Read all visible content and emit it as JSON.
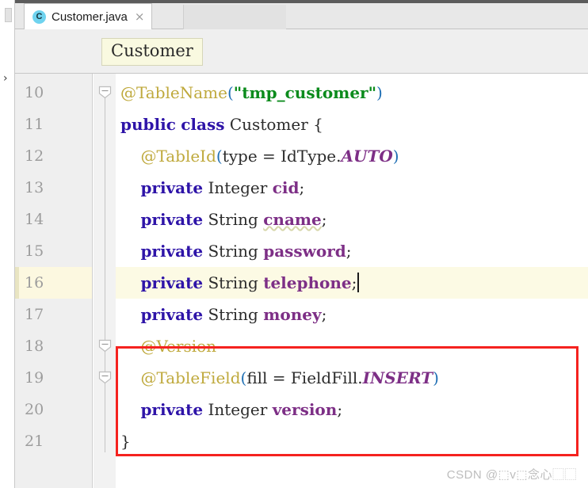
{
  "window": {
    "app": "IntelliJ IDEA editor"
  },
  "left_strip": {
    "chevron_icon": "›"
  },
  "tabbar": {
    "tab": {
      "icon_letter": "C",
      "label": "Customer.java",
      "close_icon": "×"
    }
  },
  "breadcrumb": {
    "label": "Customer"
  },
  "editor": {
    "lines": [
      {
        "number": "10",
        "active": false,
        "fold": "collapse",
        "tokens": [
          {
            "t": "@TableName",
            "c": "anno"
          },
          {
            "t": "(",
            "c": "paren"
          },
          {
            "t": "\"tmp_customer\"",
            "c": "str"
          },
          {
            "t": ")",
            "c": "paren"
          }
        ]
      },
      {
        "number": "11",
        "active": false,
        "fold": "",
        "tokens": [
          {
            "t": "public",
            "c": "kw"
          },
          {
            "t": " ",
            "c": "plain"
          },
          {
            "t": "class",
            "c": "kw"
          },
          {
            "t": " ",
            "c": "plain"
          },
          {
            "t": "Customer",
            "c": "type"
          },
          {
            "t": " {",
            "c": "punc"
          }
        ]
      },
      {
        "number": "12",
        "active": false,
        "fold": "",
        "tokens": [
          {
            "t": "    ",
            "c": "plain"
          },
          {
            "t": "@TableId",
            "c": "anno"
          },
          {
            "t": "(",
            "c": "paren"
          },
          {
            "t": "type = ",
            "c": "plain"
          },
          {
            "t": "IdType.",
            "c": "plain"
          },
          {
            "t": "AUTO",
            "c": "enumv"
          },
          {
            "t": ")",
            "c": "paren"
          }
        ]
      },
      {
        "number": "13",
        "active": false,
        "fold": "",
        "tokens": [
          {
            "t": "    ",
            "c": "plain"
          },
          {
            "t": "private",
            "c": "kw"
          },
          {
            "t": " ",
            "c": "plain"
          },
          {
            "t": "Integer",
            "c": "type"
          },
          {
            "t": " ",
            "c": "plain"
          },
          {
            "t": "cid",
            "c": "ident"
          },
          {
            "t": ";",
            "c": "punc"
          }
        ]
      },
      {
        "number": "14",
        "active": false,
        "fold": "",
        "tokens": [
          {
            "t": "    ",
            "c": "plain"
          },
          {
            "t": "private",
            "c": "kw"
          },
          {
            "t": " ",
            "c": "plain"
          },
          {
            "t": "String",
            "c": "type"
          },
          {
            "t": " ",
            "c": "plain"
          },
          {
            "t": "cname",
            "c": "fieldu"
          },
          {
            "t": ";",
            "c": "punc"
          }
        ]
      },
      {
        "number": "15",
        "active": false,
        "fold": "",
        "tokens": [
          {
            "t": "    ",
            "c": "plain"
          },
          {
            "t": "private",
            "c": "kw"
          },
          {
            "t": " ",
            "c": "plain"
          },
          {
            "t": "String",
            "c": "type"
          },
          {
            "t": " ",
            "c": "plain"
          },
          {
            "t": "password",
            "c": "ident"
          },
          {
            "t": ";",
            "c": "punc"
          }
        ]
      },
      {
        "number": "16",
        "active": true,
        "fold": "",
        "caret_after": true,
        "tokens": [
          {
            "t": "    ",
            "c": "plain"
          },
          {
            "t": "private",
            "c": "kw"
          },
          {
            "t": " ",
            "c": "plain"
          },
          {
            "t": "String",
            "c": "type"
          },
          {
            "t": " ",
            "c": "plain"
          },
          {
            "t": "telephone",
            "c": "ident"
          },
          {
            "t": ";",
            "c": "punc"
          }
        ]
      },
      {
        "number": "17",
        "active": false,
        "fold": "",
        "tokens": [
          {
            "t": "    ",
            "c": "plain"
          },
          {
            "t": "private",
            "c": "kw"
          },
          {
            "t": " ",
            "c": "plain"
          },
          {
            "t": "String",
            "c": "type"
          },
          {
            "t": " ",
            "c": "plain"
          },
          {
            "t": "money",
            "c": "ident"
          },
          {
            "t": ";",
            "c": "punc"
          }
        ]
      },
      {
        "number": "18",
        "active": false,
        "fold": "collapse",
        "tokens": [
          {
            "t": "    ",
            "c": "plain"
          },
          {
            "t": "@Version",
            "c": "anno"
          }
        ]
      },
      {
        "number": "19",
        "active": false,
        "fold": "collapse",
        "tokens": [
          {
            "t": "    ",
            "c": "plain"
          },
          {
            "t": "@TableField",
            "c": "anno"
          },
          {
            "t": "(",
            "c": "paren"
          },
          {
            "t": "fill = ",
            "c": "plain"
          },
          {
            "t": "FieldFill.",
            "c": "plain"
          },
          {
            "t": "INSERT",
            "c": "enumv"
          },
          {
            "t": ")",
            "c": "paren"
          }
        ]
      },
      {
        "number": "20",
        "active": false,
        "fold": "",
        "tokens": [
          {
            "t": "    ",
            "c": "plain"
          },
          {
            "t": "private",
            "c": "kw"
          },
          {
            "t": " ",
            "c": "plain"
          },
          {
            "t": "Integer",
            "c": "type"
          },
          {
            "t": " ",
            "c": "plain"
          },
          {
            "t": "version",
            "c": "ident"
          },
          {
            "t": ";",
            "c": "punc"
          }
        ]
      },
      {
        "number": "21",
        "active": false,
        "fold": "",
        "tokens": [
          {
            "t": "}",
            "c": "punc"
          }
        ]
      }
    ]
  },
  "annotation": {
    "highlight_color": "#f5221f"
  },
  "watermark": {
    "text": "CSDN @⬚v⬚念心⬚⬚"
  },
  "colors": {
    "keyword": "#2e14a8",
    "annotation": "#bfa93c",
    "string": "#0b8b1c",
    "identifier": "#7d2f86",
    "enum_value": "#7d2f86",
    "active_line": "#fcfae4",
    "gutter": "#efefef",
    "tab_icon": "#6fd3ef"
  }
}
